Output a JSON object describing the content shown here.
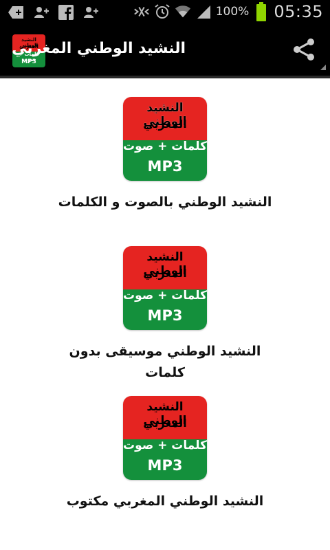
{
  "status_bar": {
    "battery_percent": "100%",
    "time": "05:35"
  },
  "action_bar": {
    "title": "النشيد الوطني المغربي"
  },
  "logo": {
    "line1": "النشيد الوطني",
    "line2": "المغربي",
    "line3": "كلمات + صوت",
    "line4": "MP3",
    "color_red": "#e52421",
    "color_green": "#14903c"
  },
  "items": [
    {
      "label": "النشيد الوطني بالصوت و الكلمات"
    },
    {
      "label": "النشيد الوطني موسيقى بدون كلمات"
    },
    {
      "label": "النشيد الوطني المغربي مكتوب"
    }
  ]
}
